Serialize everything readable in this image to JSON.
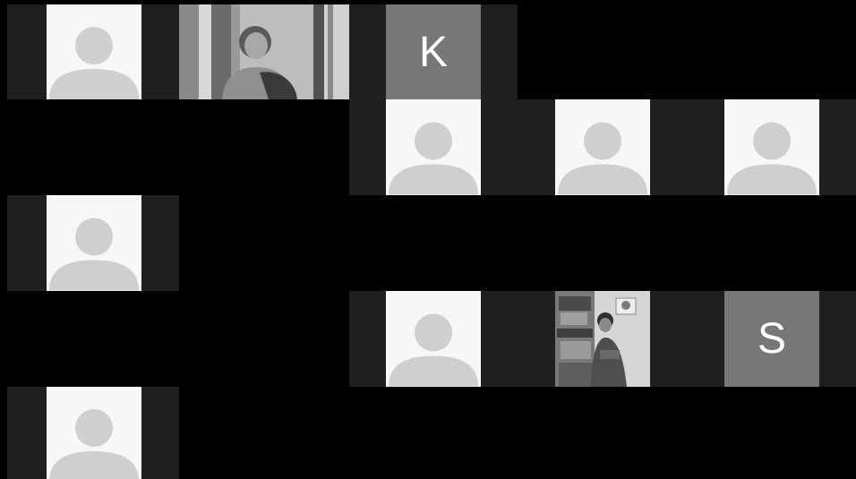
{
  "meeting": {
    "participants": [
      {
        "type": "avatar",
        "label": ""
      },
      {
        "type": "video",
        "label": ""
      },
      {
        "type": "initial",
        "label": "K"
      },
      {
        "type": "avatar",
        "label": ""
      },
      {
        "type": "avatar",
        "label": ""
      },
      {
        "type": "avatar",
        "label": ""
      },
      {
        "type": "avatar",
        "label": ""
      },
      {
        "type": "avatar",
        "label": ""
      },
      {
        "type": "video",
        "label": ""
      },
      {
        "type": "initial",
        "label": "S"
      },
      {
        "type": "avatar",
        "label": ""
      }
    ],
    "colors": {
      "background": "#000000",
      "cell": "#1f1f1f",
      "avatar_bg": "#f7f7f7",
      "avatar_fg": "#cfcfcf",
      "initial_bg": "#777777",
      "initial_fg": "#ffffff"
    },
    "icons": {
      "placeholder": "person-silhouette-icon"
    }
  }
}
